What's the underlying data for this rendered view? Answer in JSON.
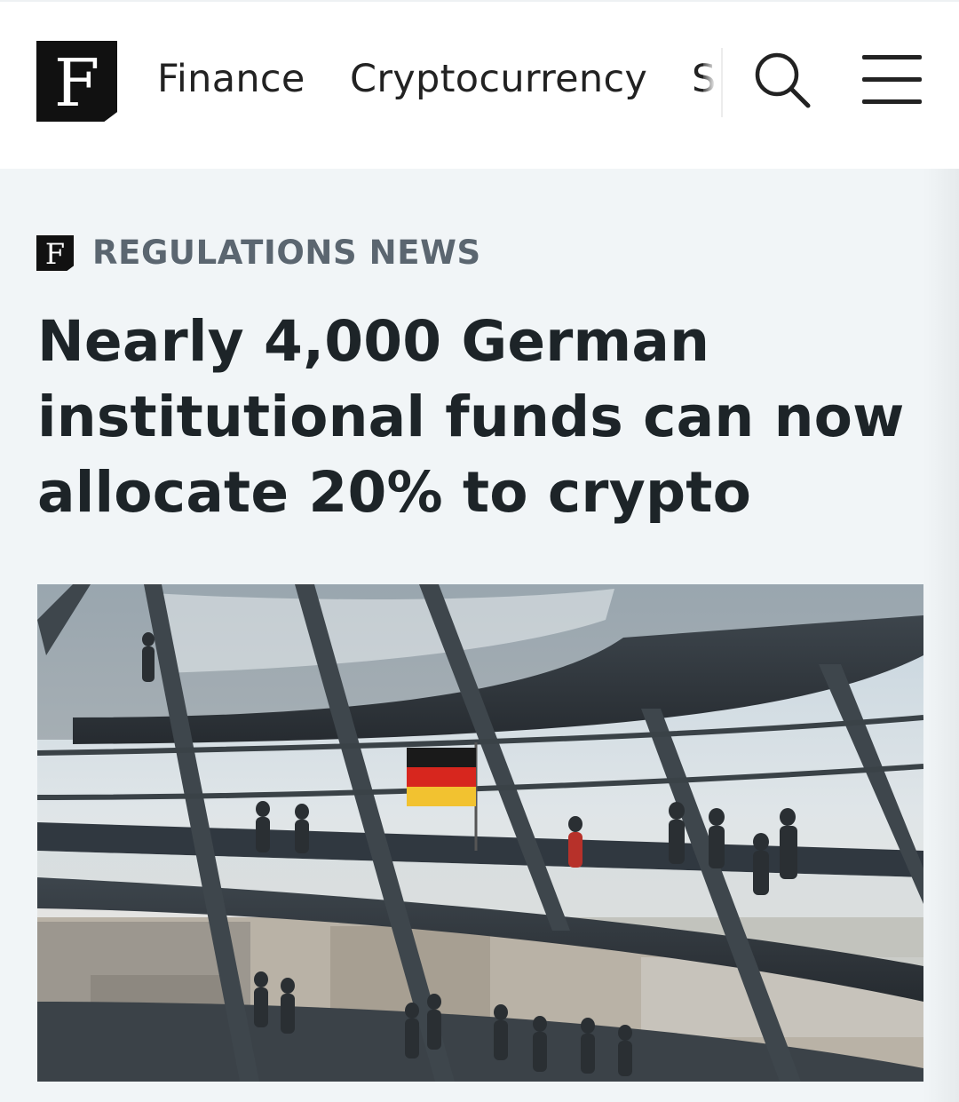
{
  "header": {
    "logo_letter": "F",
    "nav": {
      "finance": "Finance",
      "cryptocurrency": "Cryptocurrency",
      "partial_link": "St"
    },
    "icons": [
      "search-icon",
      "hamburger-menu-icon"
    ]
  },
  "article": {
    "category_logo_letter": "F",
    "category": "REGULATIONS NEWS",
    "headline": "Nearly 4,000 German institutional funds can now allocate 20% to crypto",
    "hero_image": "Reichstag dome interior with spiral ramp, visitors and German flag"
  },
  "colors": {
    "background": "#f1f5f7",
    "header_bg": "#ffffff",
    "text_dark": "#1d2428",
    "category_gray": "#5b6670",
    "flag_black": "#1a1a1a",
    "flag_red": "#d7261e",
    "flag_gold": "#f2c230"
  }
}
